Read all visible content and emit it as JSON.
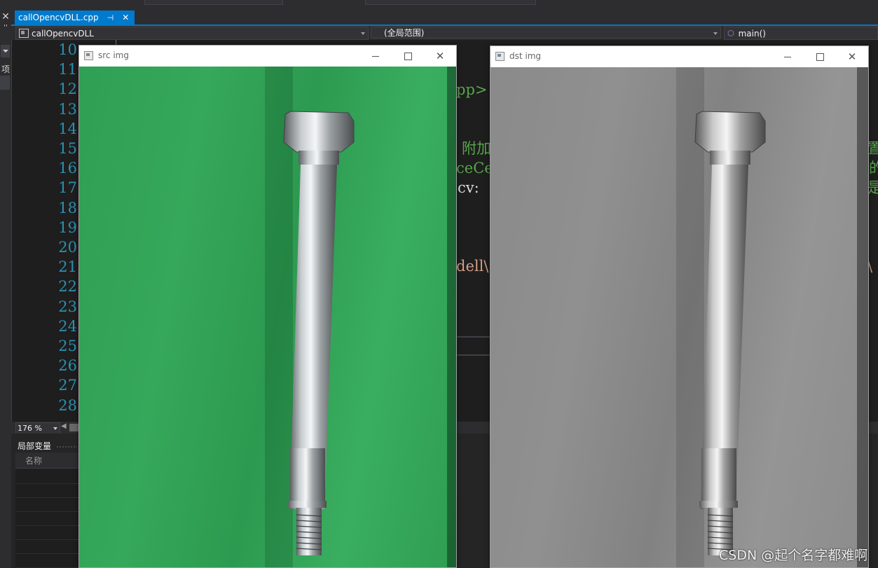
{
  "ide": {
    "tab": {
      "label": "callOpencvDLL.cpp",
      "pin": "⊣",
      "close": "✕"
    },
    "nav": {
      "project": "callOpencvDLL",
      "scope": "(全局范围)",
      "function": "main()"
    },
    "left_panel": {
      "close": "✕",
      "dots": "''",
      "item": "项"
    },
    "line_numbers": [
      "10",
      "11",
      "12",
      "13",
      "14",
      "15",
      "16",
      "17",
      "18",
      "19",
      "20",
      "21",
      "22",
      "23",
      "24",
      "25",
      "26",
      "27",
      "28"
    ],
    "code_fragments": {
      "l12": "pp>",
      "l15_a": "附加",
      "l15_b": "置",
      "l16_a": "ceCen",
      "l16_b": "的",
      "l17_a": "cv:",
      "l17_b": "是",
      "l21_a": "dell\\",
      "l21_b": "\\"
    },
    "zoom": "176 %",
    "locals_panel": {
      "title": "局部变量",
      "column": "名称"
    }
  },
  "windows": {
    "src": {
      "title": "src img"
    },
    "dst": {
      "title": "dst img"
    }
  },
  "watermark": "CSDN @起个名字都难啊",
  "colors": {
    "accent": "#007acc",
    "line_number": "#2b91af",
    "comment": "#57a64a"
  }
}
